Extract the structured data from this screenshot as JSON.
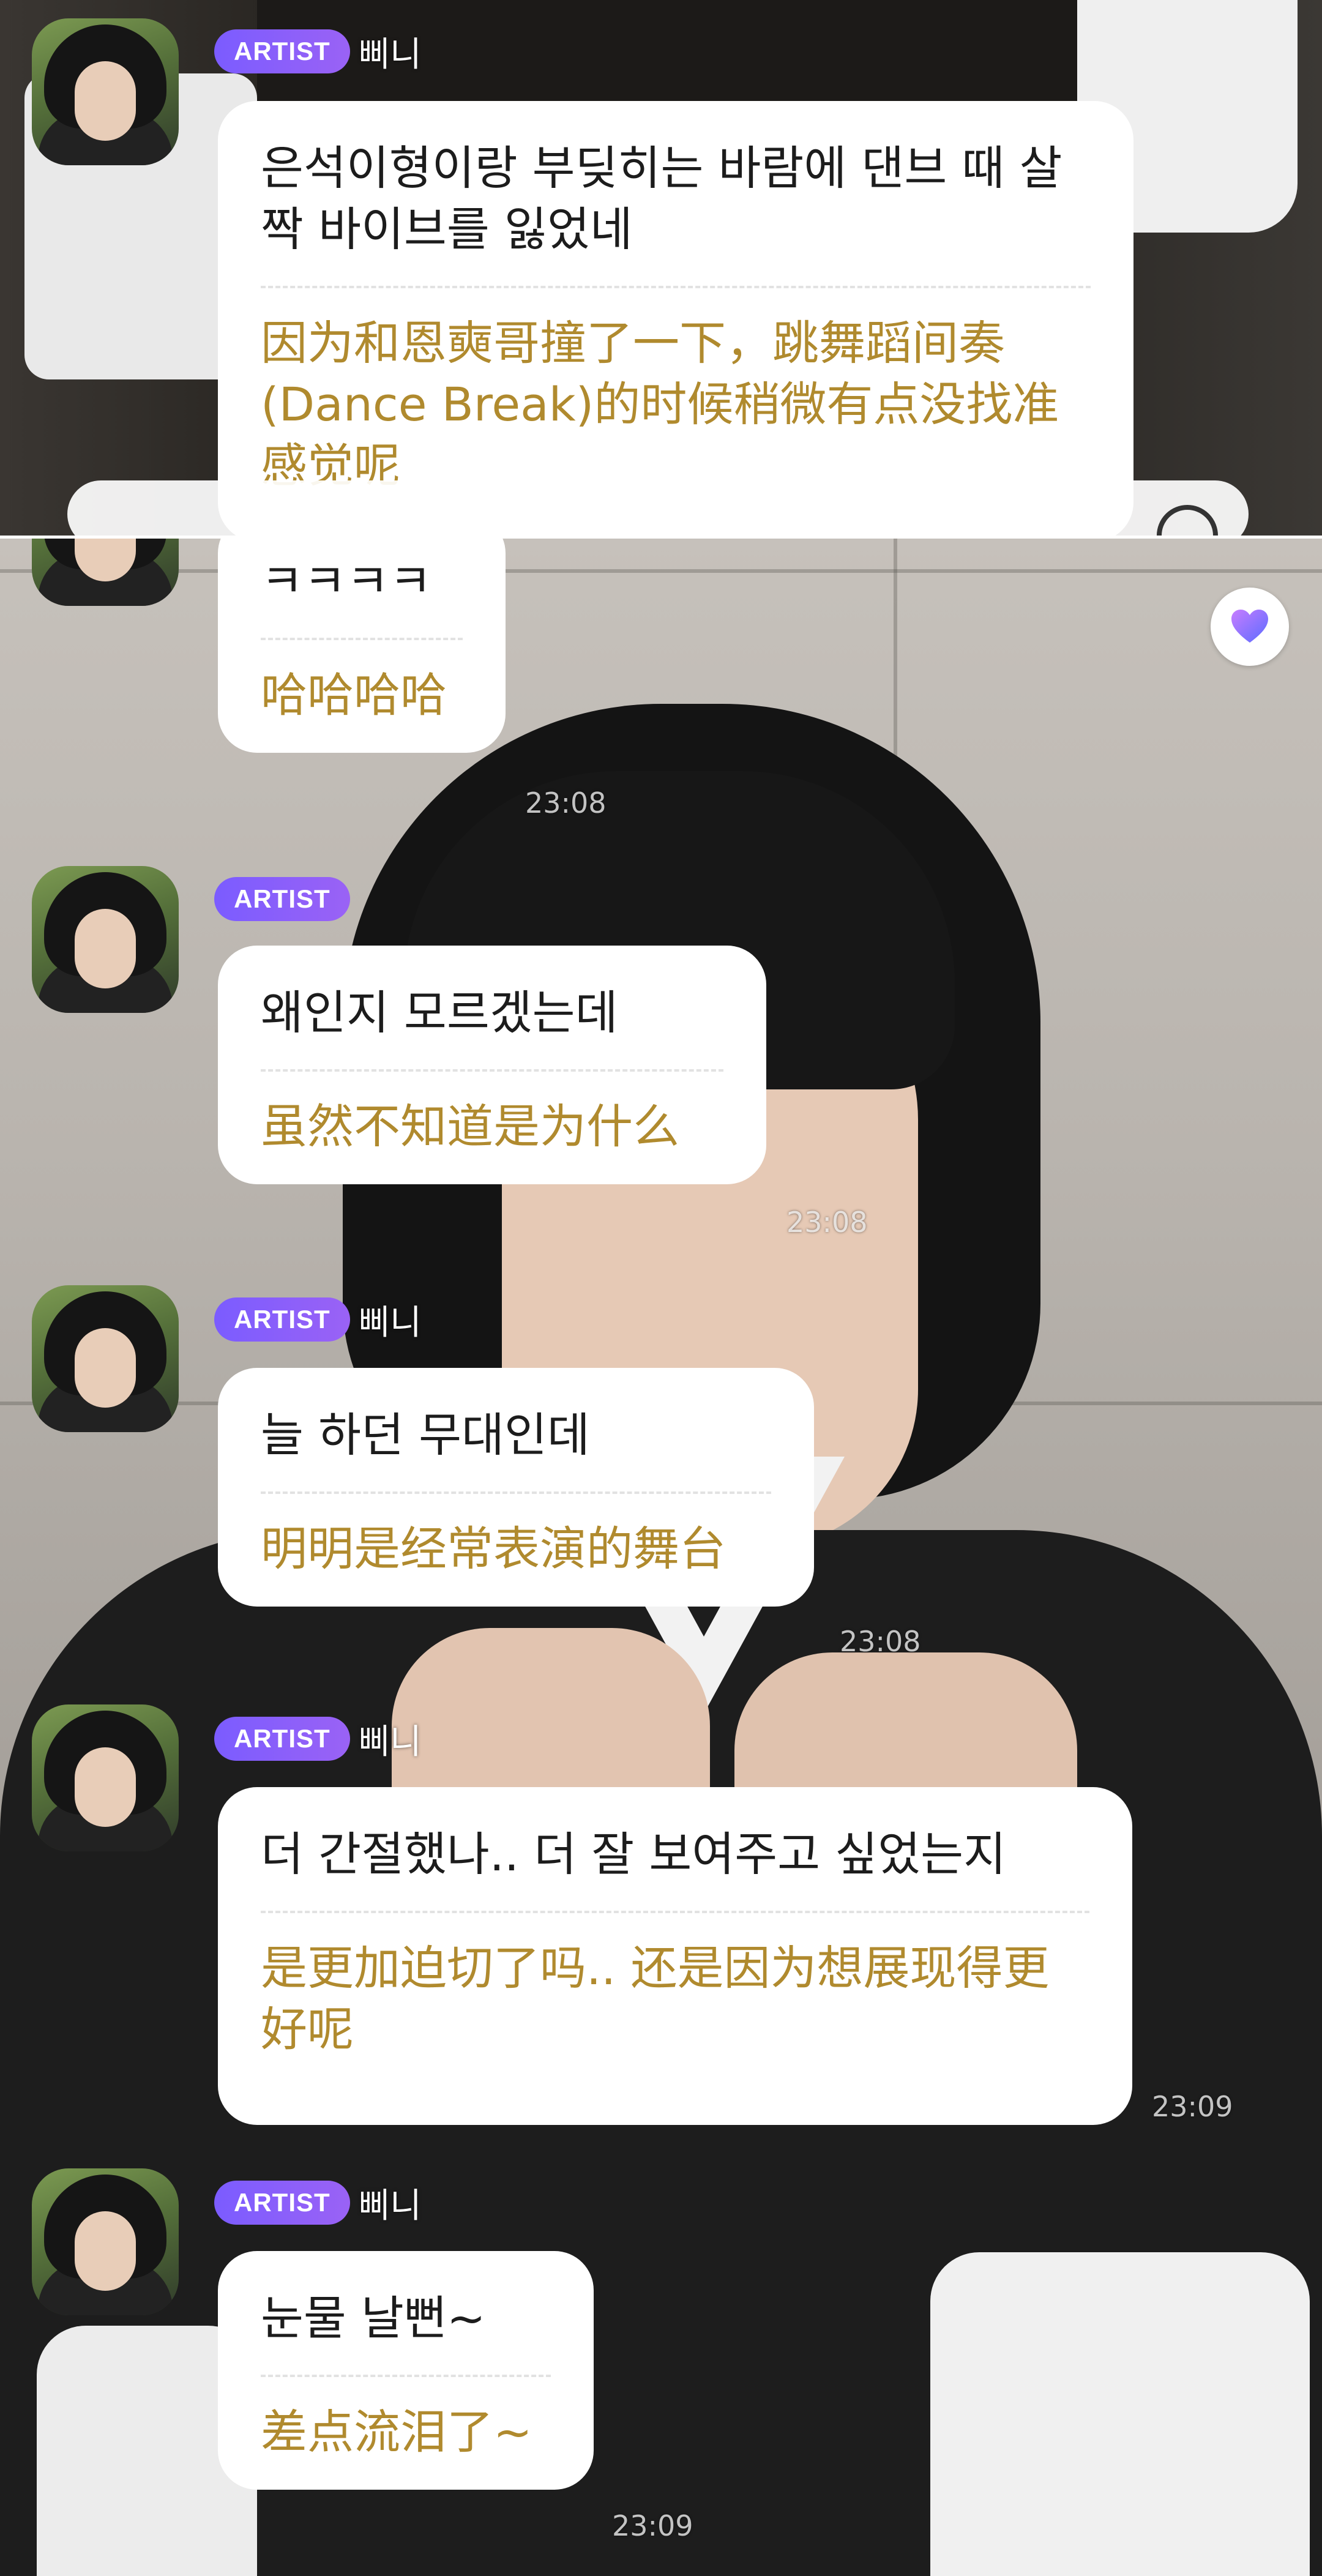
{
  "colors": {
    "artist_badge": "#8b5cf6",
    "translation_text": "#b08a2e",
    "original_text": "#1c1c1c",
    "bubble_bg": "#ffffff"
  },
  "top_panel": {
    "message": {
      "badge": "ARTIST",
      "name": "삐니",
      "original": "은석이형이랑 부딪히는 바람에 댄브 때 살짝 바이브를 잃었네",
      "translation": "因为和恩奭哥撞了一下，跳舞蹈间奏(Dance Break)的时候稍微有点没找准感觉呢"
    }
  },
  "main_panel": {
    "heart_icon": "heart-icon",
    "messages": [
      {
        "original": "ㅋㅋㅋㅋ",
        "translation": "哈哈哈哈",
        "time": "23:08"
      },
      {
        "badge": "ARTIST",
        "name": "",
        "original": "왜인지 모르겠는데",
        "translation": "虽然不知道是为什么",
        "time": "23:08"
      },
      {
        "badge": "ARTIST",
        "name": "삐니",
        "original": "늘 하던 무대인데",
        "translation": "明明是经常表演的舞台",
        "time": "23:08"
      },
      {
        "badge": "ARTIST",
        "name": "삐니",
        "original": "더 간절했나.. 더 잘 보여주고 싶었는지",
        "translation": "是更加迫切了吗.. 还是因为想展现得更好呢",
        "time": "23:09"
      },
      {
        "badge": "ARTIST",
        "name": "삐니",
        "original": "눈물 날뻔~",
        "translation": "差点流泪了~",
        "time": "23:09"
      }
    ]
  }
}
